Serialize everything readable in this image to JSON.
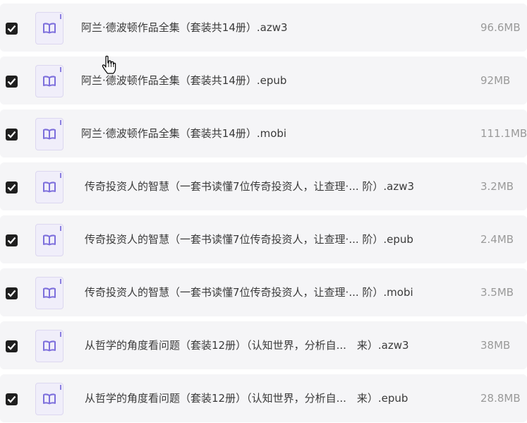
{
  "files": [
    {
      "name": "阿兰·德波顿作品全集（套装共14册）.azw3",
      "size": "96.6MB",
      "checked": true,
      "icon": "book-icon"
    },
    {
      "name": "阿兰·德波顿作品全集（套装共14册）.epub",
      "size": "92MB",
      "checked": true,
      "icon": "book-icon"
    },
    {
      "name": "阿兰·德波顿作品全集（套装共14册）.mobi",
      "size": "111.1MB",
      "checked": true,
      "icon": "book-icon"
    },
    {
      "name": "传奇投资人的智慧（一套书读懂7位传奇投资人，让查理·... 阶）.azw3",
      "size": "3.2MB",
      "checked": true,
      "icon": "book-icon"
    },
    {
      "name": "传奇投资人的智慧（一套书读懂7位传奇投资人，让查理·... 阶）.epub",
      "size": "2.4MB",
      "checked": true,
      "icon": "book-icon"
    },
    {
      "name": "传奇投资人的智慧（一套书读懂7位传奇投资人，让查理·... 阶）.mobi",
      "size": "3.5MB",
      "checked": true,
      "icon": "book-icon"
    },
    {
      "name": "从哲学的角度看问题（套装12册）（认知世界，分析自...　来）.azw3",
      "size": "38MB",
      "checked": true,
      "icon": "book-icon"
    },
    {
      "name": "从哲学的角度看问题（套装12册）（认知世界，分析自...　来）.epub",
      "size": "28.8MB",
      "checked": true,
      "icon": "book-icon"
    }
  ],
  "colors": {
    "row_bg": "#f5f5f7",
    "checkbox": "#1f1f1f",
    "icon_accent": "#8b7fe0",
    "name_text": "#3a3a3a",
    "size_text": "#9a9a9a"
  }
}
